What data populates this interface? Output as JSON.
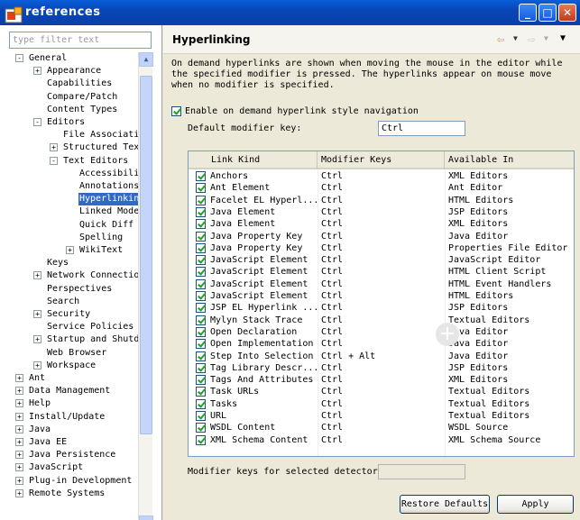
{
  "window": {
    "title": "Preferences",
    "title_visible": "references",
    "buttons": [
      "_",
      "□",
      "X"
    ]
  },
  "left": {
    "filter_placeholder": "type filter text",
    "tree": [
      {
        "label": "General",
        "level": 0,
        "expander": "-"
      },
      {
        "label": "Appearance",
        "level": 1,
        "expander": "+"
      },
      {
        "label": "Capabilities",
        "level": 1,
        "expander": ""
      },
      {
        "label": "Compare/Patch",
        "level": 1,
        "expander": ""
      },
      {
        "label": "Content Types",
        "level": 1,
        "expander": ""
      },
      {
        "label": "Editors",
        "level": 1,
        "expander": "-"
      },
      {
        "label": "File Associatic",
        "level": 2,
        "expander": ""
      },
      {
        "label": "Structured Text",
        "level": 2,
        "expander": "+"
      },
      {
        "label": "Text Editors",
        "level": 2,
        "expander": "-"
      },
      {
        "label": "Accessibilit",
        "level": 3,
        "expander": ""
      },
      {
        "label": "Annotations",
        "level": 3,
        "expander": ""
      },
      {
        "label": "Hyperlinking",
        "level": 3,
        "expander": "",
        "selected": true
      },
      {
        "label": "Linked Mode",
        "level": 3,
        "expander": ""
      },
      {
        "label": "Quick Diff",
        "level": 3,
        "expander": ""
      },
      {
        "label": "Spelling",
        "level": 3,
        "expander": ""
      },
      {
        "label": "WikiText",
        "level": 3,
        "expander": "+"
      },
      {
        "label": "Keys",
        "level": 1,
        "expander": ""
      },
      {
        "label": "Network Connection",
        "level": 1,
        "expander": "+"
      },
      {
        "label": "Perspectives",
        "level": 1,
        "expander": ""
      },
      {
        "label": "Search",
        "level": 1,
        "expander": ""
      },
      {
        "label": "Security",
        "level": 1,
        "expander": "+"
      },
      {
        "label": "Service Policies",
        "level": 1,
        "expander": ""
      },
      {
        "label": "Startup and Shutdo",
        "level": 1,
        "expander": "+"
      },
      {
        "label": "Web Browser",
        "level": 1,
        "expander": ""
      },
      {
        "label": "Workspace",
        "level": 1,
        "expander": "+"
      },
      {
        "label": "Ant",
        "level": 0,
        "expander": "+"
      },
      {
        "label": "Data Management",
        "level": 0,
        "expander": "+"
      },
      {
        "label": "Help",
        "level": 0,
        "expander": "+"
      },
      {
        "label": "Install/Update",
        "level": 0,
        "expander": "+"
      },
      {
        "label": "Java",
        "level": 0,
        "expander": "+"
      },
      {
        "label": "Java EE",
        "level": 0,
        "expander": "+"
      },
      {
        "label": "Java Persistence",
        "level": 0,
        "expander": "+"
      },
      {
        "label": "JavaScript",
        "level": 0,
        "expander": "+"
      },
      {
        "label": "Plug-in Development",
        "level": 0,
        "expander": "+"
      },
      {
        "label": "Remote Systems",
        "level": 0,
        "expander": "+"
      }
    ]
  },
  "right": {
    "page_title": "Hyperlinking",
    "description": "On demand hyperlinks are shown when moving the mouse in the editor while the specified modifier is pressed. The hyperlinks appear on mouse move when no modifier is specified.",
    "enable_label": "Enable on demand hyperlink style navigation",
    "enable_checked": true,
    "default_modifier_label": "Default modifier key:",
    "default_modifier_value": "Ctrl",
    "table": {
      "headers": [
        "Link Kind",
        "Modifier Keys",
        "Available In"
      ],
      "rows": [
        [
          "Anchors",
          "Ctrl",
          "XML Editors"
        ],
        [
          "Ant Element",
          "Ctrl",
          "Ant Editor"
        ],
        [
          "Facelet EL Hyperl...",
          "Ctrl",
          "HTML Editors"
        ],
        [
          "Java Element",
          "Ctrl",
          "JSP Editors"
        ],
        [
          "Java Element",
          "Ctrl",
          "XML Editors"
        ],
        [
          "Java Property Key",
          "Ctrl",
          "Java Editor"
        ],
        [
          "Java Property Key",
          "Ctrl",
          "Properties File Editor"
        ],
        [
          "JavaScript Element",
          "Ctrl",
          "JavaScript Editor"
        ],
        [
          "JavaScript Element",
          "Ctrl",
          "HTML Client Script"
        ],
        [
          "JavaScript Element",
          "Ctrl",
          "HTML Event Handlers"
        ],
        [
          "JavaScript Element",
          "Ctrl",
          "HTML Editors"
        ],
        [
          "JSP EL Hyperlink ...",
          "Ctrl",
          "JSP Editors"
        ],
        [
          "Mylyn Stack Trace",
          "Ctrl",
          "Textual Editors"
        ],
        [
          "Open Declaration",
          "Ctrl",
          "Java Editor"
        ],
        [
          "Open Implementation",
          "Ctrl",
          "Java Editor"
        ],
        [
          "Step Into Selection",
          "Ctrl + Alt",
          "Java Editor"
        ],
        [
          "Tag Library Descr...",
          "Ctrl",
          "JSP Editors"
        ],
        [
          "Tags And Attributes",
          "Ctrl",
          "XML Editors"
        ],
        [
          "Task URLs",
          "Ctrl",
          "Textual Editors"
        ],
        [
          "Tasks",
          "Ctrl",
          "Textual Editors"
        ],
        [
          "URL",
          "Ctrl",
          "Textual Editors"
        ],
        [
          "WSDL Content",
          "Ctrl",
          "WSDL Source"
        ],
        [
          "XML Schema Content",
          "Ctrl",
          "XML Schema Source"
        ]
      ]
    },
    "selected_modifier_label": "Modifier keys for selected detector:",
    "selected_modifier_value": "",
    "restore_label": "Restore Defaults",
    "apply_label": "Apply"
  },
  "colors": {
    "titlebar": "#0846b8",
    "selection": "#316ac5",
    "check": "#21a121"
  }
}
